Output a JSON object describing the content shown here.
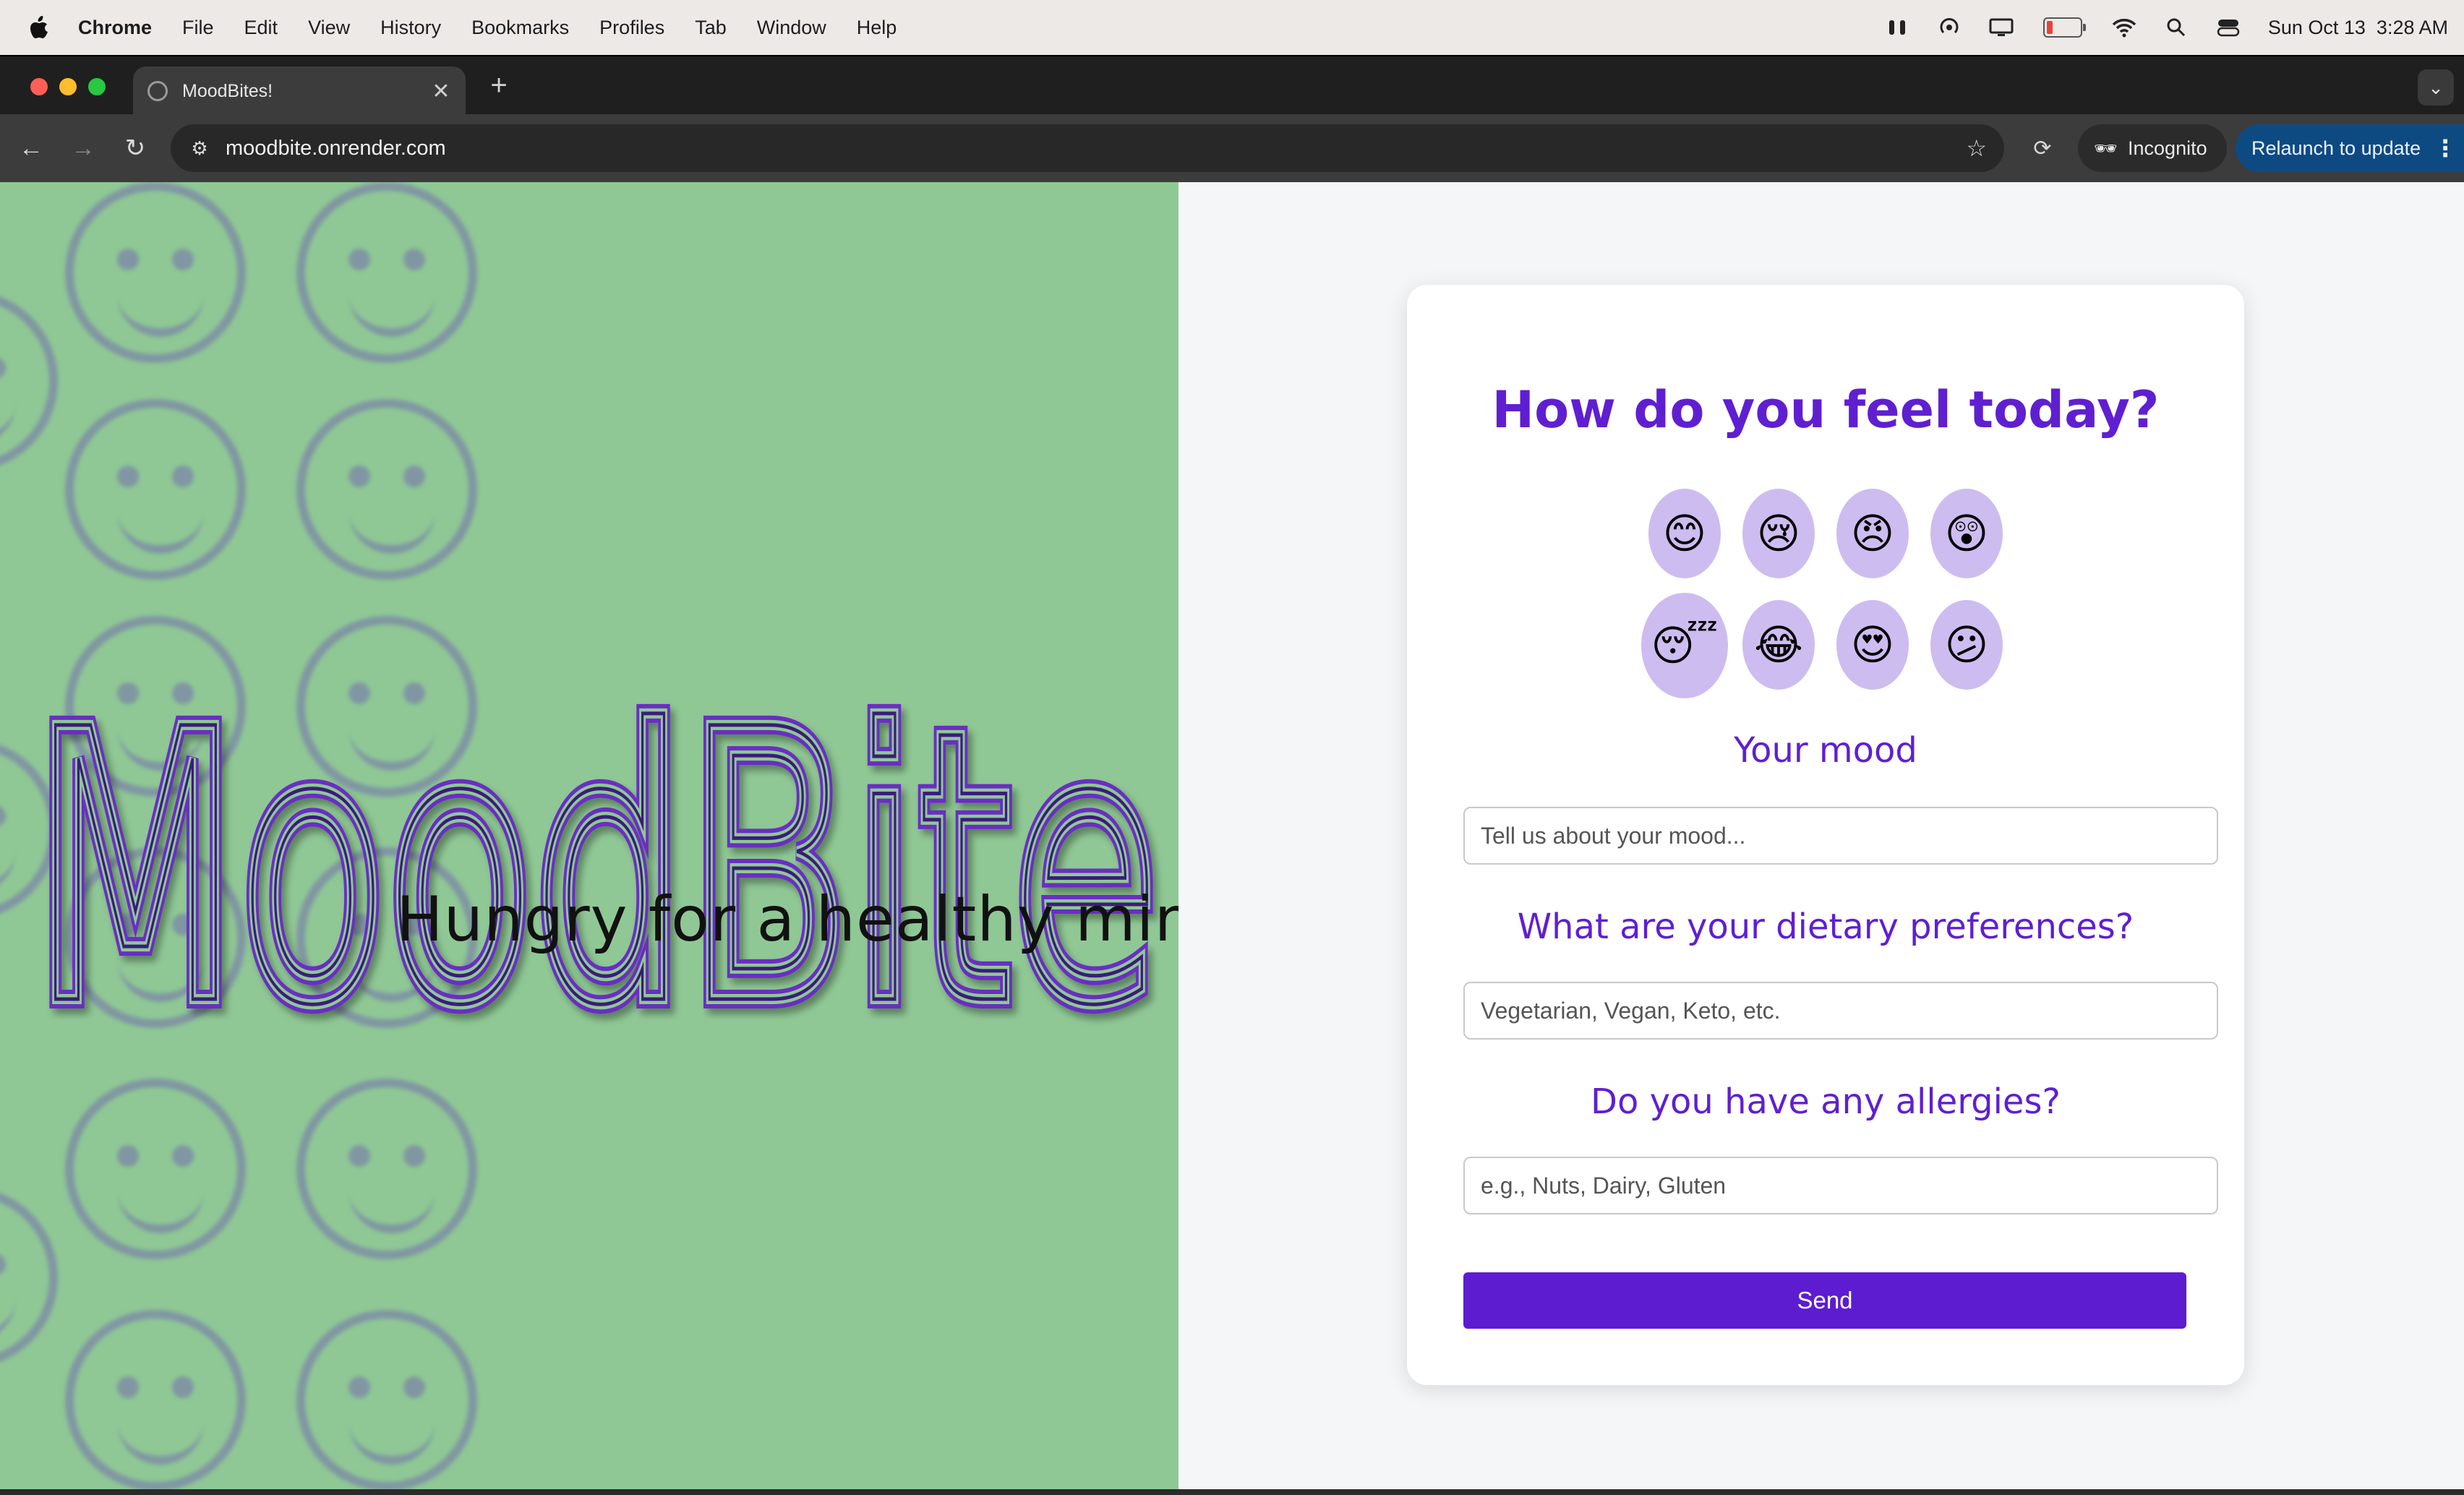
{
  "menubar": {
    "app": "Chrome",
    "items": [
      "File",
      "Edit",
      "View",
      "History",
      "Bookmarks",
      "Profiles",
      "Tab",
      "Window",
      "Help"
    ],
    "clock": "Sun Oct 13  3:28 AM"
  },
  "browser": {
    "tab_title": "MoodBites!",
    "url": "moodbite.onrender.com",
    "incognito_label": "Incognito",
    "relaunch_label": "Relaunch to update"
  },
  "hero": {
    "logo_text": "MoodBite",
    "tagline": "Hungry for a healthy mind?"
  },
  "form": {
    "heading": "How do you feel today?",
    "emojis": [
      "😊",
      "😢",
      "😠",
      "😲",
      "😴",
      "😂",
      "😍",
      "😕"
    ],
    "selected_emoji_index": 4,
    "mood_label": "Your mood",
    "mood_placeholder": "Tell us about your mood...",
    "diet_label": "What are your dietary preferences?",
    "diet_placeholder": "Vegetarian, Vegan, Keto, etc.",
    "allergy_label": "Do you have any allergies?",
    "allergy_placeholder": "e.g., Nuts, Dairy, Gluten",
    "send_label": "Send"
  },
  "colors": {
    "accent": "#5f1fd1",
    "hero_bg": "#8fc895",
    "emoji_bg": "#cdbcf0"
  }
}
